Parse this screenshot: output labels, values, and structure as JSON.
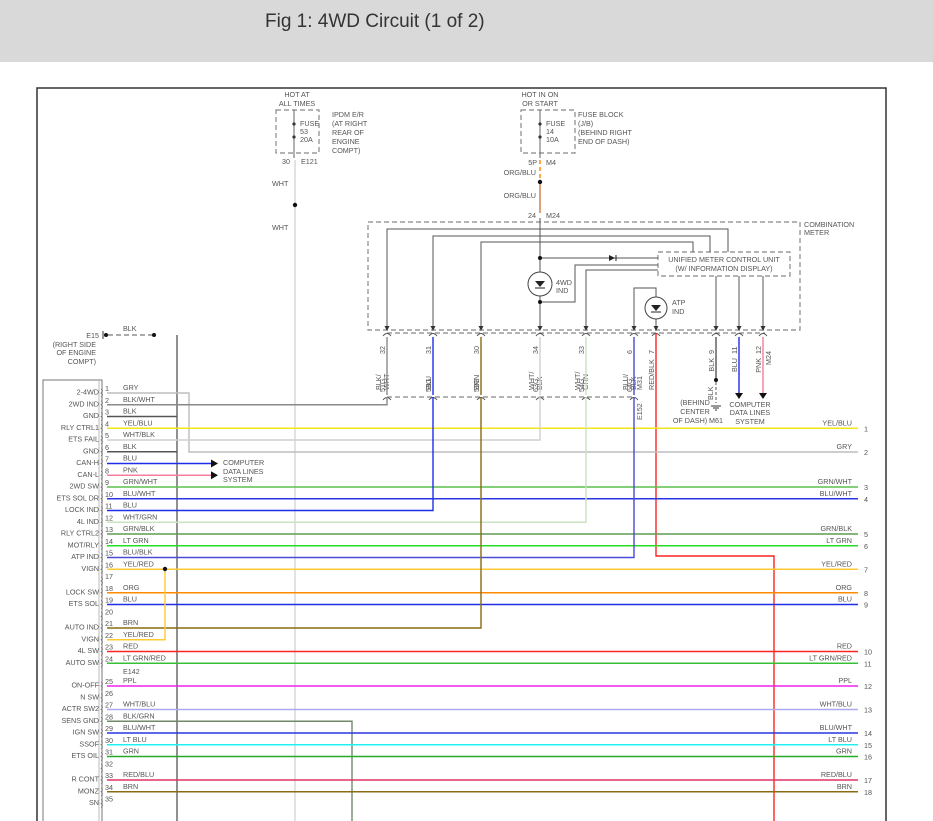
{
  "title": "Fig 1: 4WD Circuit (1 of 2)",
  "ipdm": {
    "hot_label_1": "HOT AT",
    "hot_label_2": "ALL TIMES",
    "fuse": "FUSE",
    "fuse_num": "53",
    "fuse_amp": "20A",
    "loc": [
      "IPDM E/R",
      "(AT RIGHT",
      "REAR OF",
      "ENGINE",
      "COMPT)"
    ],
    "pin": "30",
    "connector": "E121",
    "wire": "WHT"
  },
  "fuse_block": {
    "hot_label_1": "HOT IN ON",
    "hot_label_2": "OR START",
    "fuse": "FUSE",
    "fuse_num": "14",
    "fuse_amp": "10A",
    "loc": [
      "FUSE BLOCK",
      "(J/B)",
      "(BEHIND RIGHT",
      "END OF DASH)"
    ],
    "pin": "5P",
    "connector": "M4",
    "wire": "ORG/BLU",
    "meter_pin": "24",
    "meter_connector": "M24"
  },
  "combination_meter": {
    "label": [
      "COMBINATION",
      "METER"
    ],
    "unit": [
      "UNIFIED METER CONTROL UNIT",
      "(W/ INFORMATION DISPLAY)"
    ],
    "ind_4wd": [
      "4WD",
      "IND"
    ],
    "ind_atp": [
      "ATP",
      "IND"
    ],
    "pins": [
      {
        "num": "32",
        "wire": [
          "BLK/",
          "WHT"
        ],
        "conn": "51G",
        "color": "BLK/WHT"
      },
      {
        "num": "31",
        "wire": [
          "BLU"
        ],
        "conn": "53G",
        "color": "BLU"
      },
      {
        "num": "30",
        "wire": [
          "BRN"
        ],
        "conn": "52G",
        "color": "BRN"
      },
      {
        "num": "34",
        "wire": [
          "WHT/",
          "BLK"
        ],
        "conn": "63G",
        "color": "WHT/BLK"
      },
      {
        "num": "33",
        "wire": [
          "WHT/",
          "GRN"
        ],
        "conn": "54G",
        "color": "WHT/GRN"
      },
      {
        "num": "6",
        "wire": [
          "BLU/",
          "BLK"
        ],
        "conn": "64G",
        "color": "BLU/BLK"
      },
      {
        "num": "7",
        "wire": [
          "RED/BLK"
        ],
        "conn": "",
        "color": "RED"
      },
      {
        "num": "9",
        "wire": [
          "BLK"
        ],
        "conn": "",
        "color": "BLK"
      },
      {
        "num": "11",
        "wire": [
          "BLU"
        ],
        "conn": "",
        "color": "BLU"
      },
      {
        "num": "12",
        "wire": [
          "PNK"
        ],
        "conn": "",
        "color": "PNK"
      }
    ],
    "connector_m24": "M24",
    "connector_m31": "M31",
    "connector_e152": "E152",
    "ground_wire": "BLK",
    "ground_loc": [
      "(BEHIND",
      "CENTER",
      "OF DASH)"
    ],
    "ground_conn": "M61",
    "data_lines": [
      "COMPUTER",
      "DATA LINES",
      "SYSTEM"
    ]
  },
  "ground_e15": {
    "conn": "E15",
    "loc": [
      "(RIGHT SIDE",
      "OF ENGINE",
      "COMPT)"
    ],
    "wire": "BLK"
  },
  "data_lines_left": [
    "COMPUTER",
    "DATA LINES",
    "SYSTEM"
  ],
  "e142_label": "E142",
  "left_connector": {
    "pins": [
      {
        "num": "1",
        "function": "2-4WD",
        "wire": "GRY"
      },
      {
        "num": "2",
        "function": "2WD IND",
        "wire": "BLK/WHT"
      },
      {
        "num": "3",
        "function": "GND",
        "wire": "BLK"
      },
      {
        "num": "4",
        "function": "RLY CTRL1",
        "wire": "YEL/BLU"
      },
      {
        "num": "5",
        "function": "ETS FAIL",
        "wire": "WHT/BLK"
      },
      {
        "num": "6",
        "function": "GND",
        "wire": "BLK"
      },
      {
        "num": "7",
        "function": "CAN-H",
        "wire": "BLU"
      },
      {
        "num": "8",
        "function": "CAN-L",
        "wire": "PNK"
      },
      {
        "num": "9",
        "function": "2WD SW",
        "wire": "GRN/WHT"
      },
      {
        "num": "10",
        "function": "ETS SOL DR",
        "wire": "BLU/WHT"
      },
      {
        "num": "11",
        "function": "LOCK IND",
        "wire": "BLU"
      },
      {
        "num": "12",
        "function": "4L IND",
        "wire": "WHT/GRN"
      },
      {
        "num": "13",
        "function": "RLY CTRL2",
        "wire": "GRN/BLK"
      },
      {
        "num": "14",
        "function": "MOT/RLY",
        "wire": "LT GRN"
      },
      {
        "num": "15",
        "function": "ATP IND",
        "wire": "BLU/BLK"
      },
      {
        "num": "16",
        "function": "VIGN",
        "wire": "YEL/RED"
      },
      {
        "num": "17",
        "function": "",
        "wire": ""
      },
      {
        "num": "18",
        "function": "LOCK SW",
        "wire": "ORG"
      },
      {
        "num": "19",
        "function": "ETS SOL",
        "wire": "BLU"
      },
      {
        "num": "20",
        "function": "",
        "wire": ""
      },
      {
        "num": "21",
        "function": "AUTO IND",
        "wire": "BRN"
      },
      {
        "num": "22",
        "function": "VIGN",
        "wire": "YEL/RED"
      },
      {
        "num": "23",
        "function": "4L SW",
        "wire": "RED"
      },
      {
        "num": "24",
        "function": "AUTO SW",
        "wire": "LT GRN/RED"
      },
      {
        "num": "25",
        "function": "ON-OFF",
        "wire": "PPL"
      },
      {
        "num": "26",
        "function": "N SW",
        "wire": ""
      },
      {
        "num": "27",
        "function": "ACTR SW2",
        "wire": "WHT/BLU"
      },
      {
        "num": "28",
        "function": "SENS GND",
        "wire": "BLK/GRN"
      },
      {
        "num": "29",
        "function": "IGN SW",
        "wire": "BLU/WHT"
      },
      {
        "num": "30",
        "function": "SSOF",
        "wire": "LT BLU"
      },
      {
        "num": "31",
        "function": "ETS OIL",
        "wire": "GRN"
      },
      {
        "num": "32",
        "function": "",
        "wire": ""
      },
      {
        "num": "33",
        "function": "R CONT",
        "wire": "RED/BLU"
      },
      {
        "num": "34",
        "function": "MONZ",
        "wire": "BRN"
      },
      {
        "num": "35",
        "function": "SN",
        "wire": ""
      }
    ]
  },
  "right_terminals": [
    {
      "num": "1",
      "label": "YEL/BLU",
      "pin": "4"
    },
    {
      "num": "2",
      "label": "GRY",
      "pin": "1"
    },
    {
      "num": "3",
      "label": "GRN/WHT",
      "pin": "9"
    },
    {
      "num": "4",
      "label": "BLU/WHT",
      "pin": "10"
    },
    {
      "num": "5",
      "label": "GRN/BLK",
      "pin": "13"
    },
    {
      "num": "6",
      "label": "LT GRN",
      "pin": "14"
    },
    {
      "num": "7",
      "label": "YEL/RED",
      "pin": "16"
    },
    {
      "num": "8",
      "label": "ORG",
      "pin": "18"
    },
    {
      "num": "9",
      "label": "BLU",
      "pin": "19"
    },
    {
      "num": "10",
      "label": "RED",
      "pin": "23"
    },
    {
      "num": "11",
      "label": "LT GRN/RED",
      "pin": "24"
    },
    {
      "num": "12",
      "label": "PPL",
      "pin": "25"
    },
    {
      "num": "13",
      "label": "WHT/BLU",
      "pin": "27"
    },
    {
      "num": "14",
      "label": "BLU/WHT",
      "pin": "29"
    },
    {
      "num": "15",
      "label": "LT BLU",
      "pin": "30"
    },
    {
      "num": "16",
      "label": "GRN",
      "pin": "31"
    },
    {
      "num": "17",
      "label": "RED/BLU",
      "pin": "33"
    },
    {
      "num": "18",
      "label": "BRN",
      "pin": "34"
    }
  ],
  "wire_colors": {
    "GRY": "#bdbdbd",
    "BLK/WHT": "#8a8a8a",
    "BLK": "#555555",
    "YEL/BLU": "#f2e61a",
    "WHT/BLK": "#cfcfcf",
    "BLU": "#1f2de8",
    "PNK": "#f27f9b",
    "GRN/WHT": "#5cbf4f",
    "BLU/WHT": "#2a36e0",
    "WHT/GRN": "#c9e2c2",
    "GRN/BLK": "#5d9c52",
    "LT GRN": "#25dd25",
    "BLU/BLK": "#4a4ad6",
    "YEL/RED": "#ffc933",
    "ORG": "#ff8a00",
    "BRN": "#8a6a12",
    "RED": "#ff2424",
    "LT GRN/RED": "#35c035",
    "PPL": "#ee22ee",
    "WHT/BLU": "#aaaaee",
    "BLK/GRN": "#6f8a6a",
    "LT BLU": "#1ff0f0",
    "GRN": "#25aa25",
    "RED/BLU": "#e03366",
    "WHT": "#d8d8d8",
    "ORG/BLU": "#e87a20"
  }
}
